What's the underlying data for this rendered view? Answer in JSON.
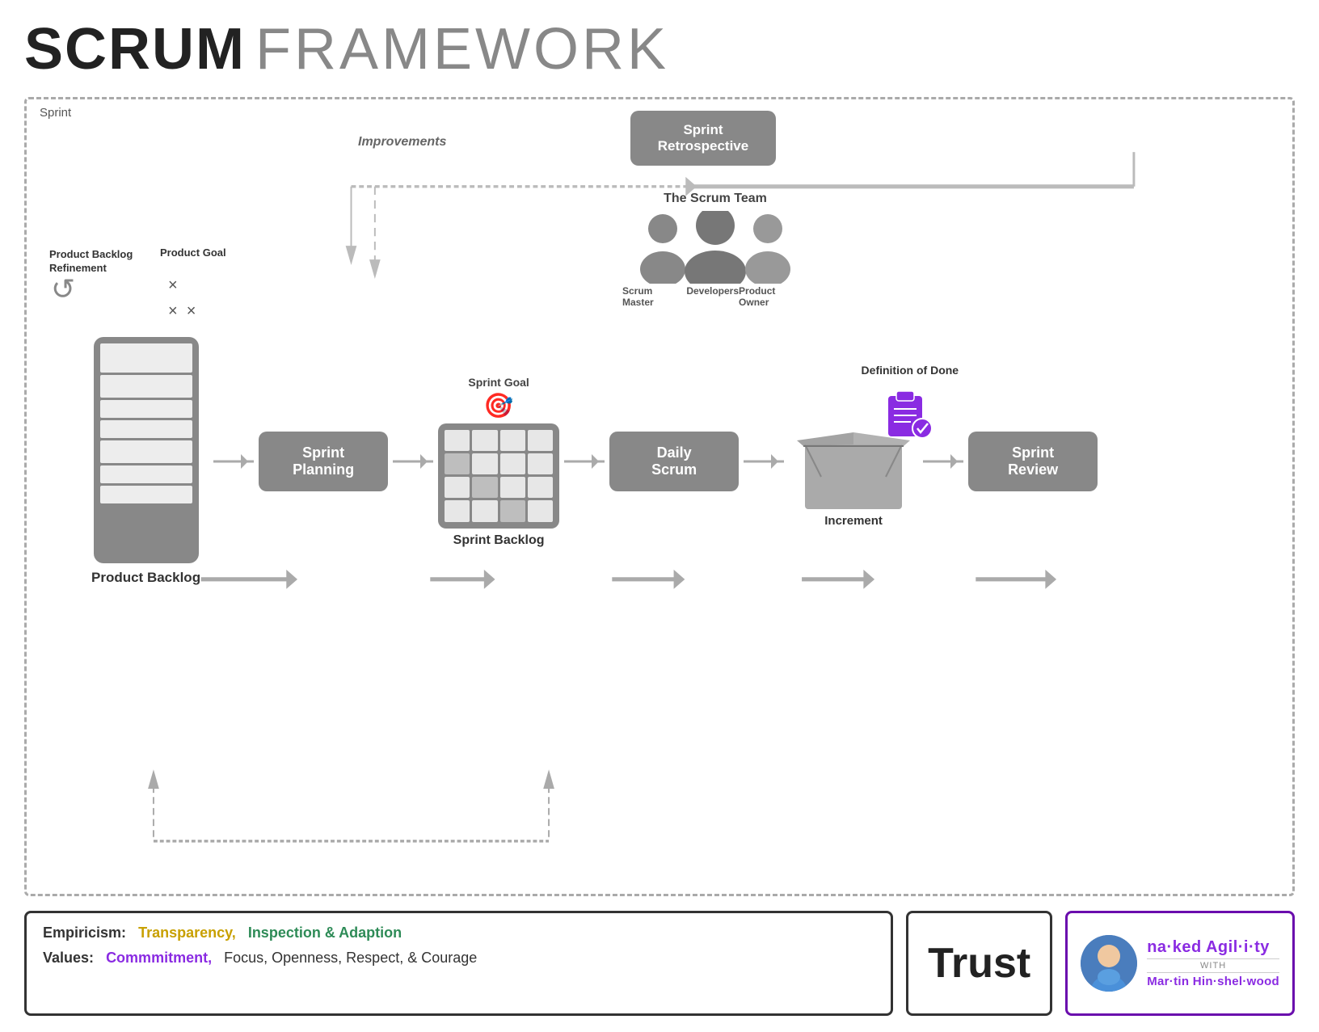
{
  "title": {
    "bold": "SCRUM",
    "light": "FRAMEWORK"
  },
  "sprint_label": "Sprint",
  "improvements_label": "Improvements",
  "refinement_label": "Product Backlog\nRefinement",
  "product_goal_label": "Product Goal",
  "product_backlog_label": "Product Backlog",
  "sprint_goal_label": "Sprint Goal",
  "sprint_backlog_label": "Sprint Backlog",
  "daily_scrum_label": "Daily\nScrum",
  "increment_label": "Increment",
  "dod_label": "Definition of Done",
  "sprint_planning_label": "Sprint\nPlanning",
  "sprint_review_label": "Sprint\nReview",
  "sprint_retrospective_label": "Sprint\nRetrospective",
  "team": {
    "title": "The Scrum Team",
    "roles": {
      "left": "Scrum Master",
      "center": "Developers",
      "right": "Product Owner"
    }
  },
  "bottom": {
    "empiricism_label": "Empiricism:",
    "transparency": "Transparency,",
    "inspection_adaption": "Inspection & Adaption",
    "values_label": "Values:",
    "commitment": "Commmitment,",
    "other_values": "Focus, Openness, Respect, & Courage",
    "trust_label": "Trust",
    "brand_name_bold": "na·ked Agil·i·ty",
    "brand_with": "WITH",
    "brand_person": "Mar·tin Hin·shel·wood"
  },
  "colors": {
    "accent_purple": "#8a2be2",
    "accent_yellow": "#c8a000",
    "accent_green": "#2e8b57",
    "box_gray": "#888888",
    "text_dark": "#222222",
    "text_mid": "#555555",
    "border": "#333333"
  }
}
